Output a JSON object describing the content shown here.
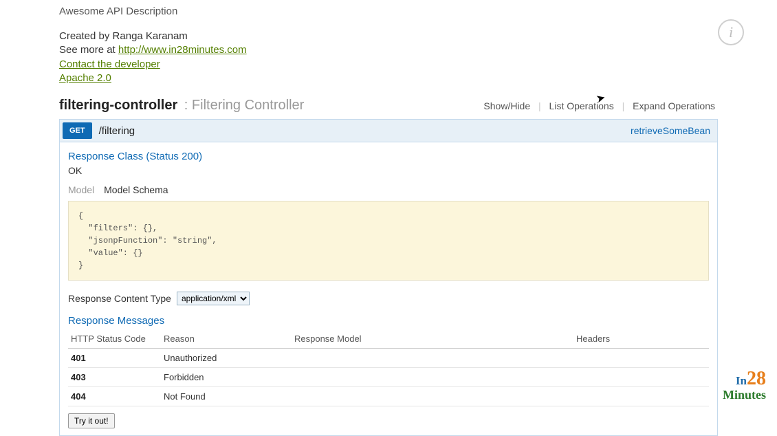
{
  "header": {
    "title": "Awesome API Description",
    "created_prefix": "Created by ",
    "created_by": "Ranga Karanam",
    "see_more_prefix": "See more at ",
    "see_more_url": "http://www.in28minutes.com",
    "contact_label": "Contact the developer",
    "license_label": "Apache 2.0"
  },
  "controller": {
    "name": "filtering-controller",
    "sep": " : ",
    "desc": "Filtering Controller",
    "actions": {
      "showhide": "Show/Hide",
      "list": "List Operations",
      "expand": "Expand Operations"
    }
  },
  "operation": {
    "method": "GET",
    "path": "/filtering",
    "op_name": "retrieveSomeBean",
    "response_class_title": "Response Class (Status 200)",
    "ok_text": "OK",
    "model_tab_inactive": "Model",
    "model_tab_active": "Model Schema",
    "schema_lines": "{\n  \"filters\": {},\n  \"jsonpFunction\": \"string\",\n  \"value\": {}\n}",
    "rct_label": "Response Content Type",
    "rct_value": "application/xml",
    "response_messages_title": "Response Messages",
    "columns": {
      "code": "HTTP Status Code",
      "reason": "Reason",
      "model": "Response Model",
      "headers": "Headers"
    },
    "rows": [
      {
        "code": "401",
        "reason": "Unauthorized"
      },
      {
        "code": "403",
        "reason": "Forbidden"
      },
      {
        "code": "404",
        "reason": "Not Found"
      }
    ],
    "tryit": "Try it out!"
  },
  "info_icon": "i",
  "logo": {
    "in": "In",
    "n28": "28",
    "min": "Minutes"
  }
}
